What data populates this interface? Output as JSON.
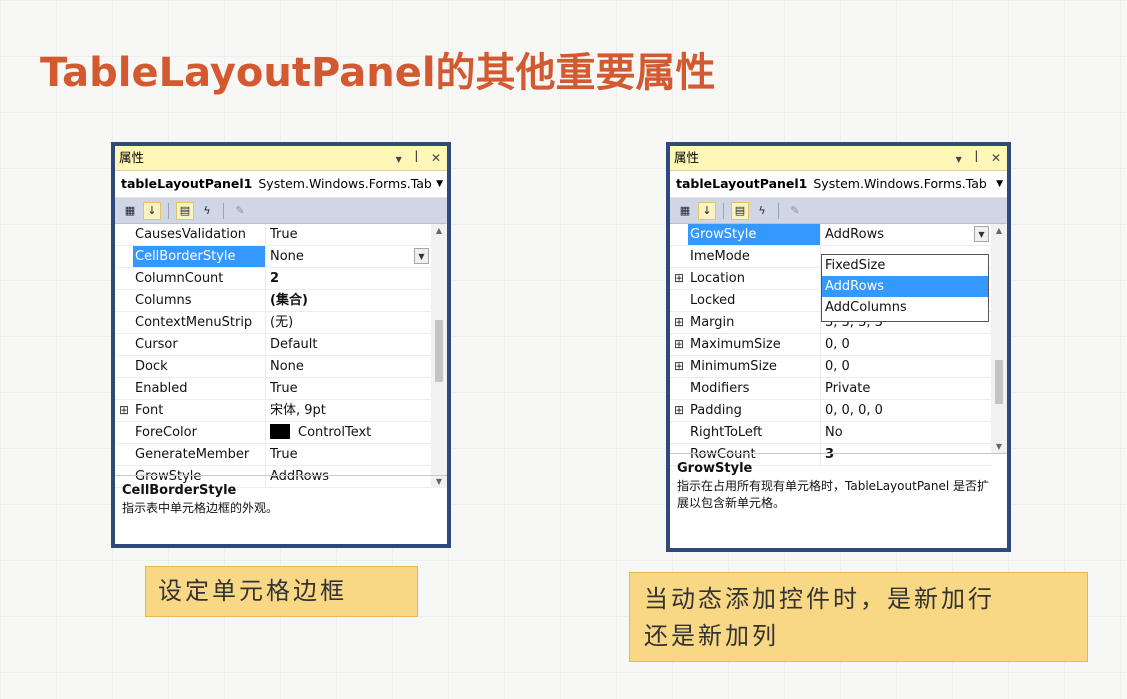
{
  "slide_title": "TableLayoutPanel的其他重要属性",
  "left_panel": {
    "window_title": "属性",
    "title_buttons": {
      "dropdown": "▼",
      "pin": "ꟾ",
      "close": "✕"
    },
    "object_name": "tableLayoutPanel1",
    "object_type": "System.Windows.Forms.Tab",
    "toolbar_icons": [
      "categorized-icon",
      "alphabetical-icon",
      "properties-icon",
      "events-icon",
      "property-pages-icon"
    ],
    "rows": [
      {
        "expand": "",
        "name": "CausesValidation",
        "value": "True"
      },
      {
        "expand": "",
        "name": "CellBorderStyle",
        "value": "None"
      },
      {
        "expand": "",
        "name": "ColumnCount",
        "value": "2"
      },
      {
        "expand": "",
        "name": "Columns",
        "value": "(集合)"
      },
      {
        "expand": "",
        "name": "ContextMenuStrip",
        "value": "(无)"
      },
      {
        "expand": "",
        "name": "Cursor",
        "value": "Default"
      },
      {
        "expand": "",
        "name": "Dock",
        "value": "None"
      },
      {
        "expand": "",
        "name": "Enabled",
        "value": "True"
      },
      {
        "expand": "⊞",
        "name": "Font",
        "value": "宋体, 9pt"
      },
      {
        "expand": "",
        "name": "ForeColor",
        "value": "ControlText"
      },
      {
        "expand": "",
        "name": "GenerateMember",
        "value": "True"
      },
      {
        "expand": "",
        "name": "GrowStyle",
        "value": "AddRows"
      }
    ],
    "selected_row": "CellBorderStyle",
    "forecolor_swatch": "#000000",
    "desc_title": "CellBorderStyle",
    "desc_text": "指示表中单元格边框的外观。"
  },
  "right_panel": {
    "window_title": "属性",
    "title_buttons": {
      "dropdown": "▼",
      "pin": "ꟾ",
      "close": "✕"
    },
    "object_name": "tableLayoutPanel1",
    "object_type": "System.Windows.Forms.Tab",
    "toolbar_icons": [
      "categorized-icon",
      "alphabetical-icon",
      "properties-icon",
      "events-icon",
      "property-pages-icon"
    ],
    "rows": [
      {
        "expand": "",
        "name": "GrowStyle",
        "value": "AddRows"
      },
      {
        "expand": "",
        "name": "ImeMode",
        "value": ""
      },
      {
        "expand": "⊞",
        "name": "Location",
        "value": ""
      },
      {
        "expand": "",
        "name": "Locked",
        "value": ""
      },
      {
        "expand": "⊞",
        "name": "Margin",
        "value": "3, 3, 3, 3"
      },
      {
        "expand": "⊞",
        "name": "MaximumSize",
        "value": "0, 0"
      },
      {
        "expand": "⊞",
        "name": "MinimumSize",
        "value": "0, 0"
      },
      {
        "expand": "",
        "name": "Modifiers",
        "value": "Private"
      },
      {
        "expand": "⊞",
        "name": "Padding",
        "value": "0, 0, 0, 0"
      },
      {
        "expand": "",
        "name": "RightToLeft",
        "value": "No"
      },
      {
        "expand": "",
        "name": "RowCount",
        "value": "3"
      }
    ],
    "selected_row": "GrowStyle",
    "dropdown_options": [
      "FixedSize",
      "AddRows",
      "AddColumns"
    ],
    "dropdown_selected": "AddRows",
    "desc_title": "GrowStyle",
    "desc_text": "指示在占用所有现有单元格时，TableLayoutPanel 是否扩展以包含新单元格。"
  },
  "notes": {
    "left": "设定单元格边框",
    "right_line1": "当动态添加控件时，是新加行",
    "right_line2": "还是新加列"
  },
  "colors": {
    "title": "#d35a30",
    "window_border": "#2f4a7a",
    "titlebar_bg": "#fff7b8",
    "selection": "#3399ff",
    "note_bg": "#f9d885"
  }
}
